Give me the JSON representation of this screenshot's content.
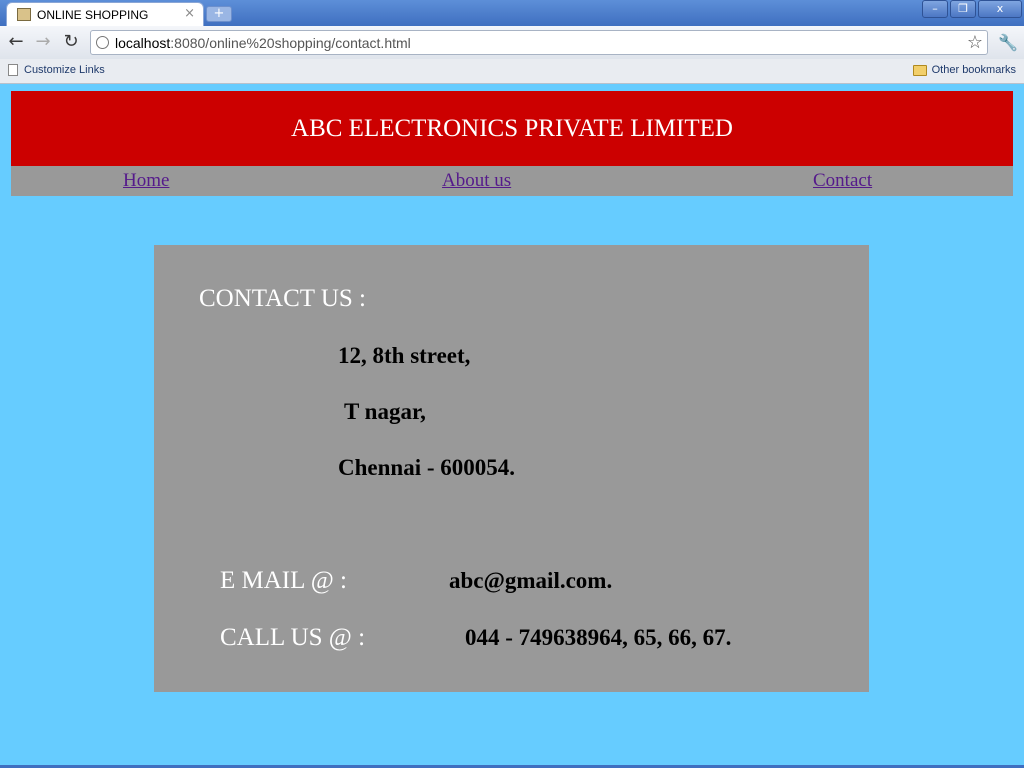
{
  "browser": {
    "tab_title": "ONLINE SHOPPING",
    "tab_close": "×",
    "new_tab": "+",
    "url_host": "localhost",
    "url_rest": ":8080/online%20shopping/contact.html",
    "bookmarks_left": "Customize Links",
    "bookmarks_right": "Other bookmarks",
    "window_buttons": {
      "minimize": "–",
      "restore": "❐",
      "close": "x"
    }
  },
  "header": {
    "title": "ABC ELECTRONICS PRIVATE LIMITED"
  },
  "nav": {
    "home": "Home",
    "about": "About us",
    "contact": "Contact"
  },
  "contact": {
    "heading": "CONTACT US :",
    "address_line1": "12, 8th street,",
    "address_line2": "T nagar,",
    "address_line3": "Chennai - 600054.",
    "email_label": "E MAIL @ :",
    "email_value": "abc@gmail.com.",
    "call_label": "CALL US @ :",
    "call_value": "044 - 749638964, 65, 66, 67."
  },
  "colors": {
    "page_background": "#66ccff",
    "header_background": "#cc0000",
    "nav_background": "#999999",
    "panel_background": "#999999",
    "link": "#551a8b"
  }
}
